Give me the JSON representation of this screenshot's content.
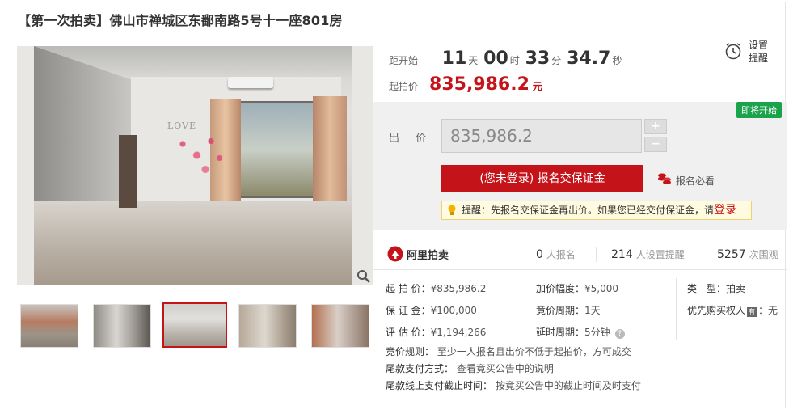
{
  "title": "【第一次拍卖】佛山市禅城区东鄱南路5号十一座801房",
  "gallery": {
    "wall_text": "LOVE",
    "zoom_icon": "magnifier-icon",
    "thumbnails": [
      "thumb-1",
      "thumb-2",
      "thumb-3",
      "thumb-4",
      "thumb-5"
    ],
    "selected_index": 2
  },
  "countdown": {
    "label": "距开始",
    "days": "11",
    "days_unit": "天",
    "hours": "00",
    "hours_unit": "时",
    "minutes": "33",
    "minutes_unit": "分",
    "seconds": "34.7",
    "seconds_unit": "秒"
  },
  "reminder": {
    "label": "设置提醒",
    "icon": "alarm-clock-icon"
  },
  "start_price": {
    "label": "起拍价",
    "value": "835,986.2",
    "unit": "元"
  },
  "bid": {
    "status_badge": "即将开始",
    "label": "出 价",
    "input_value": "835,986.2",
    "plus": "+",
    "minus": "−",
    "signup_button": "(您未登录) 报名交保证金",
    "must_read": "报名必看",
    "tip_text": "提醒：先报名交保证金再出价。如果您已经交付保证金，请",
    "tip_login": "登录"
  },
  "stats": {
    "brand": "阿里拍卖",
    "signups": "0",
    "signups_label": "人报名",
    "reminders": "214",
    "reminders_label": "人设置提醒",
    "views": "5257",
    "views_label": "次围观"
  },
  "details": {
    "start_price_k": "起 拍 价：",
    "start_price_v": "¥835,986.2",
    "increment_k": "加价幅度：",
    "increment_v": "¥5,000",
    "type_k": "类　型：",
    "type_v": "拍卖",
    "deposit_k": "保 证 金：",
    "deposit_v": "¥100,000",
    "cycle_k": "竟价周期：",
    "cycle_v": "1天",
    "priority_k": "优先购买权人",
    "priority_tag": "🈶",
    "priority_v": "：无",
    "appraisal_k": "评 估 价：",
    "appraisal_v": "¥1,194,266",
    "delay_k": "延时周期：",
    "delay_v": "5分钟"
  },
  "rules": {
    "rule_k": "竞价规则：",
    "rule_v": "至少一人报名且出价不低于起拍价，方可成交",
    "payment_k": "尾款支付方式：",
    "payment_v": "查看竟买公告中的说明",
    "deadline_k": "尾款线上支付截止时间：",
    "deadline_v": "按竟买公告中的截止时间及时支付"
  },
  "colors": {
    "accent": "#c5131a",
    "badge": "#1aa34a",
    "tip_bg": "#fffbe0"
  }
}
